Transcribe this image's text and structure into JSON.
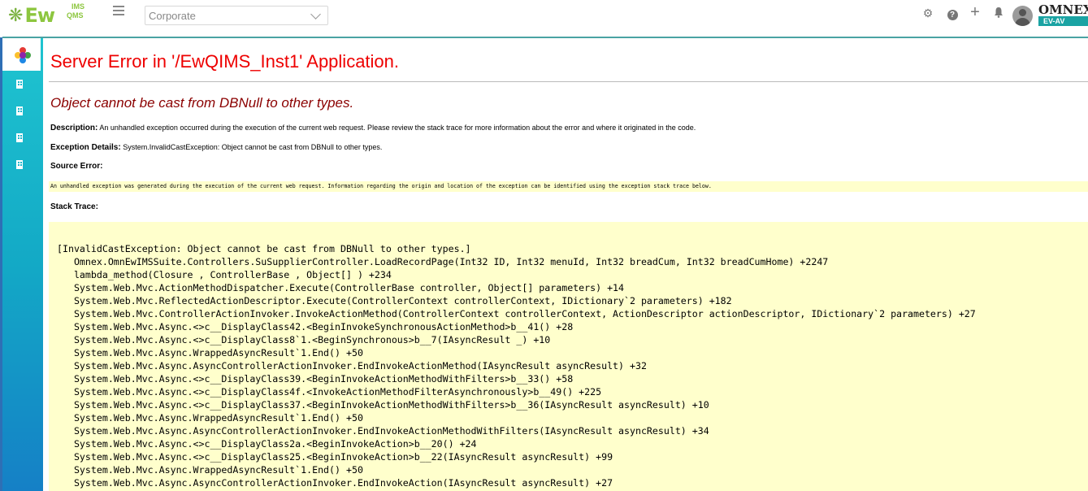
{
  "header": {
    "logo_text": "Ew",
    "logo_ims": "IMS",
    "logo_qms": "QMS",
    "company_select_value": "Corporate",
    "brand_name": "OMNEX",
    "brand_tag": "EV-AV",
    "icons": [
      "settings-icon",
      "help-icon",
      "plus-icon",
      "bell-icon",
      "avatar"
    ]
  },
  "sidebar": {
    "items": [
      {
        "icon": "app-logo-icon"
      },
      {
        "icon": "building-icon"
      },
      {
        "icon": "building-icon"
      },
      {
        "icon": "building-icon"
      },
      {
        "icon": "building-icon"
      }
    ]
  },
  "error": {
    "title": "Server Error in '/EwQIMS_Inst1' Application.",
    "subtitle": "Object cannot be cast from DBNull to other types.",
    "description_label": "Description:",
    "description_text": " An unhandled exception occurred during the execution of the current web request. Please review the stack trace for more information about the error and where it originated in the code.",
    "exception_label": "Exception Details:",
    "exception_text": " System.InvalidCastException: Object cannot be cast from DBNull to other types.",
    "source_error_label": "Source Error:",
    "source_error_text": "An unhandled exception was generated during the execution of the current web request. Information regarding the origin and location of the exception can be identified using the exception stack trace below.",
    "stack_trace_label": "Stack Trace:",
    "stack_trace": "[InvalidCastException: Object cannot be cast from DBNull to other types.]\n   Omnex.OmnEwIMSSuite.Controllers.SuSupplierController.LoadRecordPage(Int32 ID, Int32 menuId, Int32 breadCum, Int32 breadCumHome) +2247\n   lambda_method(Closure , ControllerBase , Object[] ) +234\n   System.Web.Mvc.ActionMethodDispatcher.Execute(ControllerBase controller, Object[] parameters) +14\n   System.Web.Mvc.ReflectedActionDescriptor.Execute(ControllerContext controllerContext, IDictionary`2 parameters) +182\n   System.Web.Mvc.ControllerActionInvoker.InvokeActionMethod(ControllerContext controllerContext, ActionDescriptor actionDescriptor, IDictionary`2 parameters) +27\n   System.Web.Mvc.Async.<>c__DisplayClass42.<BeginInvokeSynchronousActionMethod>b__41() +28\n   System.Web.Mvc.Async.<>c__DisplayClass8`1.<BeginSynchronous>b__7(IAsyncResult _) +10\n   System.Web.Mvc.Async.WrappedAsyncResult`1.End() +50\n   System.Web.Mvc.Async.AsyncControllerActionInvoker.EndInvokeActionMethod(IAsyncResult asyncResult) +32\n   System.Web.Mvc.Async.<>c__DisplayClass39.<BeginInvokeActionMethodWithFilters>b__33() +58\n   System.Web.Mvc.Async.<>c__DisplayClass4f.<InvokeActionMethodFilterAsynchronously>b__49() +225\n   System.Web.Mvc.Async.<>c__DisplayClass37.<BeginInvokeActionMethodWithFilters>b__36(IAsyncResult asyncResult) +10\n   System.Web.Mvc.Async.WrappedAsyncResult`1.End() +50\n   System.Web.Mvc.Async.AsyncControllerActionInvoker.EndInvokeActionMethodWithFilters(IAsyncResult asyncResult) +34\n   System.Web.Mvc.Async.<>c__DisplayClass2a.<BeginInvokeAction>b__20() +24\n   System.Web.Mvc.Async.<>c__DisplayClass25.<BeginInvokeAction>b__22(IAsyncResult asyncResult) +99\n   System.Web.Mvc.Async.WrappedAsyncResult`1.End() +50\n   System.Web.Mvc.Async.AsyncControllerActionInvoker.EndInvokeAction(IAsyncResult asyncResult) +27"
  },
  "colors": {
    "error_title": "#ee0000",
    "error_subtitle": "#8b0000",
    "code_background": "#ffffcc",
    "sidebar_teal": "#13a9c6",
    "brand_teal": "#1aa3a3",
    "logo_green": "#8dc63f"
  }
}
